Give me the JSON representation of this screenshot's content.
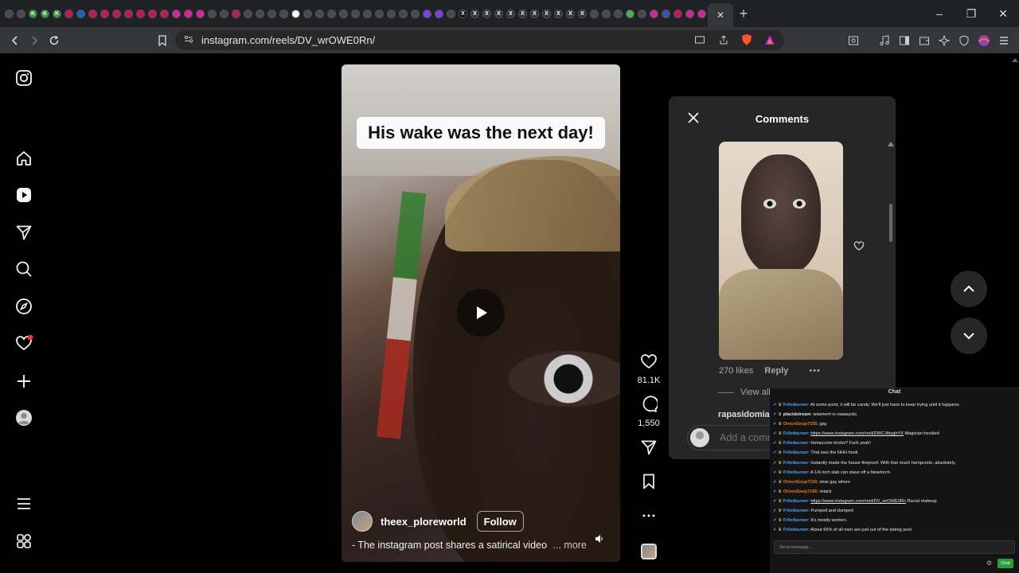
{
  "browser": {
    "tabs": [
      {
        "glyph": "",
        "color": "#4a4a4a"
      },
      {
        "glyph": "",
        "color": "#4a4a4a"
      },
      {
        "glyph": "K",
        "color": "#2e9c3e"
      },
      {
        "glyph": "K",
        "color": "#2e9c3e"
      },
      {
        "glyph": "K",
        "color": "#2e9c3e"
      },
      {
        "glyph": "",
        "color": "#c2185b"
      },
      {
        "glyph": "",
        "color": "#1565c0"
      },
      {
        "glyph": "",
        "color": "#c2185b"
      },
      {
        "glyph": "",
        "color": "#c2185b"
      },
      {
        "glyph": "",
        "color": "#c2185b"
      },
      {
        "glyph": "",
        "color": "#c2185b"
      },
      {
        "glyph": "",
        "color": "#c2185b"
      },
      {
        "glyph": "",
        "color": "#c2185b"
      },
      {
        "glyph": "",
        "color": "#c2185b"
      },
      {
        "glyph": "",
        "color": "#d6249f"
      },
      {
        "glyph": "",
        "color": "#d6249f"
      },
      {
        "glyph": "",
        "color": "#d6249f"
      },
      {
        "glyph": "",
        "color": "#4a4a4a"
      },
      {
        "glyph": "",
        "color": "#4a4a4a"
      },
      {
        "glyph": "",
        "color": "#c2185b"
      },
      {
        "glyph": "",
        "color": "#4a4a4a"
      },
      {
        "glyph": "",
        "color": "#4a4a4a"
      },
      {
        "glyph": "",
        "color": "#4a4a4a"
      },
      {
        "glyph": "",
        "color": "#4a4a4a"
      },
      {
        "glyph": "",
        "color": "#fafafa"
      },
      {
        "glyph": "",
        "color": "#4a4a4a"
      },
      {
        "glyph": "",
        "color": "#4a4a4a"
      },
      {
        "glyph": "",
        "color": "#4a4a4a"
      },
      {
        "glyph": "",
        "color": "#4a4a4a"
      },
      {
        "glyph": "",
        "color": "#4a4a4a"
      },
      {
        "glyph": "",
        "color": "#4a4a4a"
      },
      {
        "glyph": "",
        "color": "#4a4a4a"
      },
      {
        "glyph": "",
        "color": "#4a4a4a"
      },
      {
        "glyph": "",
        "color": "#4a4a4a"
      },
      {
        "glyph": "",
        "color": "#4a4a4a"
      },
      {
        "glyph": "",
        "color": "#7b3fe4"
      },
      {
        "glyph": "",
        "color": "#7b3fe4"
      },
      {
        "glyph": "",
        "color": "#4a4a4a"
      },
      {
        "glyph": "X",
        "color": "#111111"
      },
      {
        "glyph": "X",
        "color": "#333333"
      },
      {
        "glyph": "X",
        "color": "#333333"
      },
      {
        "glyph": "X",
        "color": "#333333"
      },
      {
        "glyph": "X",
        "color": "#333333"
      },
      {
        "glyph": "X",
        "color": "#333333"
      },
      {
        "glyph": "X",
        "color": "#333333"
      },
      {
        "glyph": "X",
        "color": "#333333"
      },
      {
        "glyph": "X",
        "color": "#333333"
      },
      {
        "glyph": "X",
        "color": "#333333"
      },
      {
        "glyph": "X",
        "color": "#333333"
      },
      {
        "glyph": "",
        "color": "#4a4a4a"
      },
      {
        "glyph": "",
        "color": "#4a4a4a"
      },
      {
        "glyph": "",
        "color": "#4a4a4a"
      },
      {
        "glyph": "",
        "color": "#4caf50"
      },
      {
        "glyph": "",
        "color": "#4a4a4a"
      },
      {
        "glyph": "",
        "color": "#d6249f"
      },
      {
        "glyph": "",
        "color": "#3f51b5"
      },
      {
        "glyph": "",
        "color": "#c2185b"
      },
      {
        "glyph": "",
        "color": "#d6249f"
      },
      {
        "glyph": "",
        "color": "#d6249f"
      }
    ],
    "url": "instagram.com/reels/DV_wrOWE0Rn/",
    "close_tab": "✕",
    "new_tab": "+"
  },
  "reel": {
    "overlay_caption": "His wake was the next day!",
    "author": "theex_ploreworld",
    "follow_label": "Follow",
    "description": "- The instagram post shares a satirical video",
    "more_label": "... more",
    "likes": "81.1K",
    "comments_count": "1,550"
  },
  "comments_panel": {
    "title": "Comments",
    "likes": "270 likes",
    "reply": "Reply",
    "view_all": "View all",
    "next_user": "rapasidomia...",
    "input_placeholder": "Add a comm"
  },
  "chat": {
    "title": "Chat",
    "messages": [
      {
        "user": "Fr0stburner",
        "text": "At some point, it will be candy. We'll just have to keep trying until it happens.",
        "color": "#4aa3ff",
        "link": ""
      },
      {
        "user": "placidstream",
        "text": "wawmort is raaaaycils",
        "color": "#e8e8e8",
        "link": ""
      },
      {
        "user": "OnionSoup7155",
        "text": "gay",
        "color": "#e07b1a",
        "link": ""
      },
      {
        "user": "Fr0stburner",
        "text": "Magician heckled",
        "color": "#4aa3ff",
        "link": "https://www.instagram.com/reel/DWCJtbyghYX"
      },
      {
        "user": "Fr0stburner",
        "text": "Hempcrete bricks? Fuck yeah!",
        "color": "#4aa3ff",
        "link": ""
      },
      {
        "user": "Fr0stburner",
        "text": "That was the NHH hook",
        "color": "#4aa3ff",
        "link": ""
      },
      {
        "user": "Fr0stburner",
        "text": "Instantly made the house fireproof. With that much hempcrete, absolutely.",
        "color": "#4aa3ff",
        "link": ""
      },
      {
        "user": "Fr0stburner",
        "text": "A 1/4 inch slab can stave off a blowtorch.",
        "color": "#4aa3ff",
        "link": ""
      },
      {
        "user": "OnionSoup7155",
        "text": "slow gay whore",
        "color": "#e07b1a",
        "link": ""
      },
      {
        "user": "OnionSoup7155",
        "text": "retard",
        "color": "#e07b1a",
        "link": ""
      },
      {
        "user": "Fr0stburner",
        "text": "Racist makeup",
        "color": "#4aa3ff",
        "link": "https://www.instagram.com/reel/DV_wrOWE0Rn"
      },
      {
        "user": "Fr0stburner",
        "text": "Pumped and dumped",
        "color": "#4aa3ff",
        "link": ""
      },
      {
        "user": "Fr0stburner",
        "text": "It's mostly women.",
        "color": "#4aa3ff",
        "link": ""
      },
      {
        "user": "Fr0stburner",
        "text": "About 65% of all men are just out of the dating pool",
        "color": "#4aa3ff",
        "link": ""
      }
    ],
    "input_placeholder": "Send message...",
    "send_label": "Chat"
  }
}
